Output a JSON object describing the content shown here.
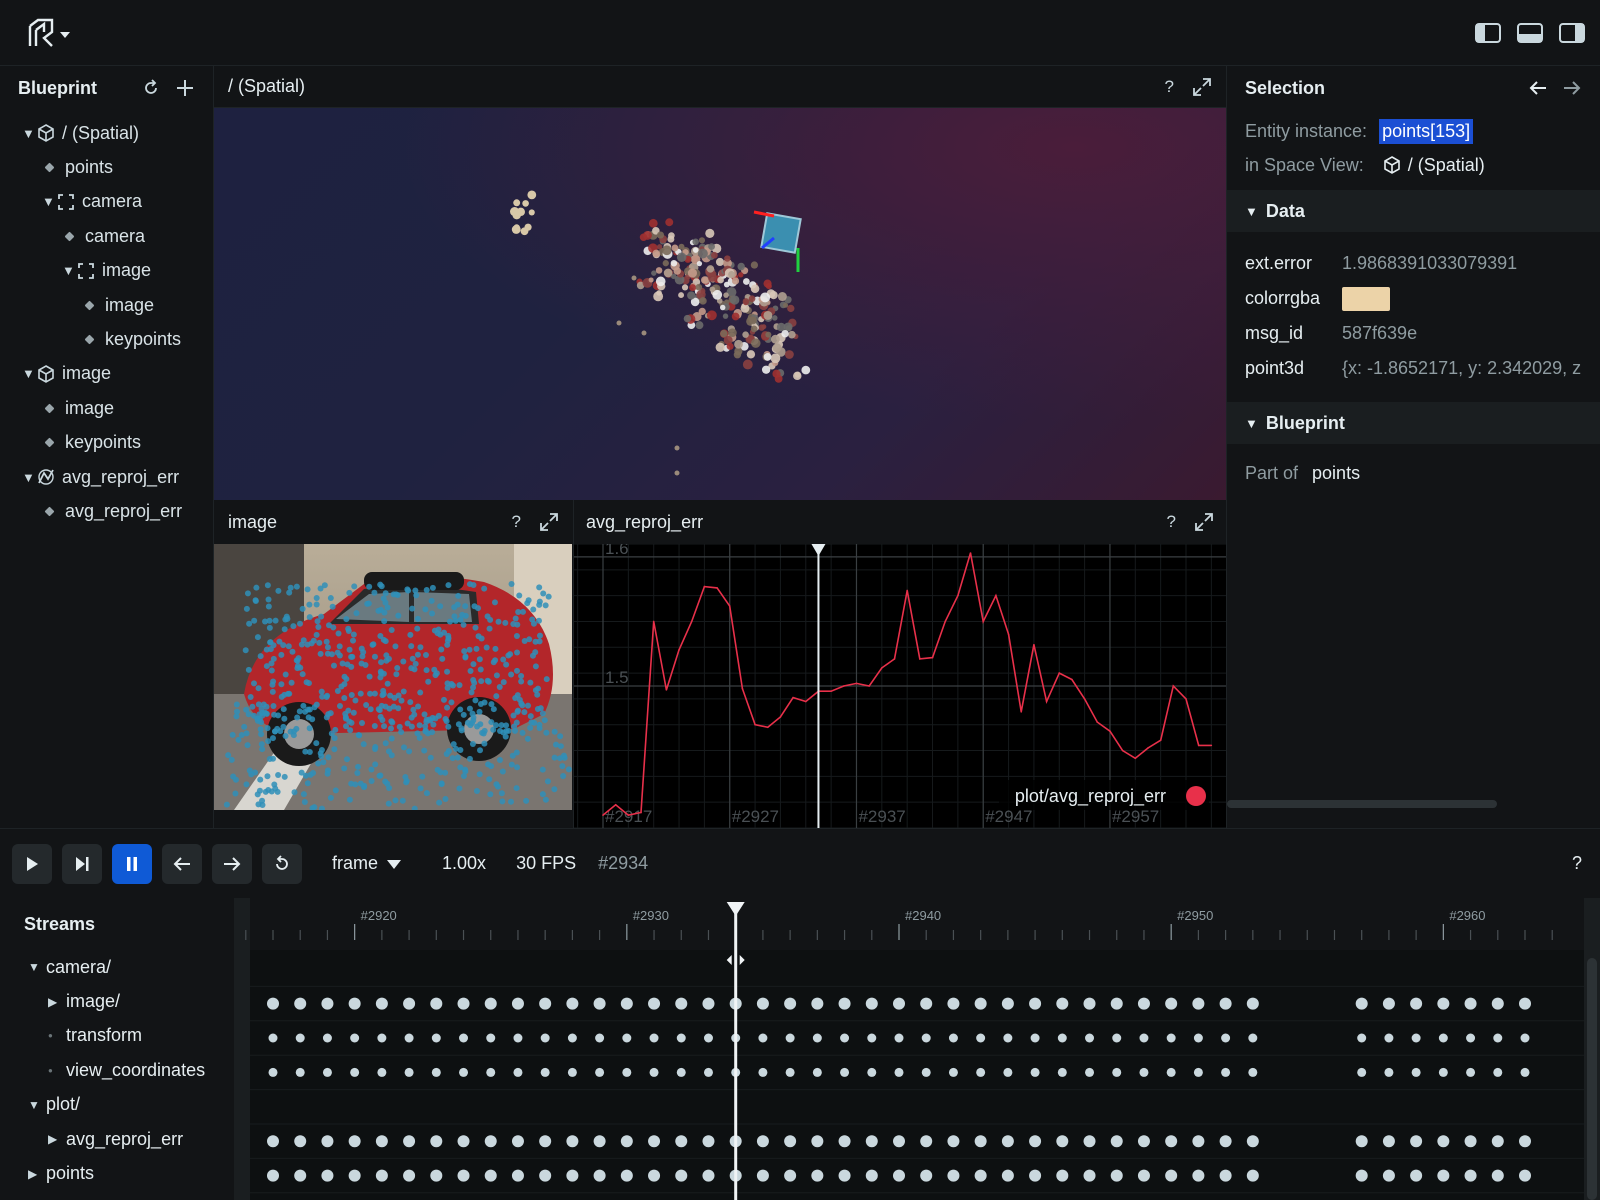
{
  "blueprint": {
    "title": "Blueprint",
    "tree": [
      {
        "label": "/ (Spatial)",
        "indent": 0,
        "kind": "expanded",
        "icon": "cube-icon"
      },
      {
        "label": "points",
        "indent": 1,
        "kind": "leaf",
        "icon": ""
      },
      {
        "label": "camera",
        "indent": 1,
        "kind": "expanded",
        "icon": "frame-icon"
      },
      {
        "label": "camera",
        "indent": 2,
        "kind": "leaf",
        "icon": ""
      },
      {
        "label": "image",
        "indent": 2,
        "kind": "expanded",
        "icon": "frame-icon"
      },
      {
        "label": "image",
        "indent": 3,
        "kind": "leaf",
        "icon": ""
      },
      {
        "label": "keypoints",
        "indent": 3,
        "kind": "leaf",
        "icon": ""
      },
      {
        "label": "image",
        "indent": 0,
        "kind": "expanded",
        "icon": "cube-icon"
      },
      {
        "label": "image",
        "indent": 1,
        "kind": "leaf",
        "icon": ""
      },
      {
        "label": "keypoints",
        "indent": 1,
        "kind": "leaf",
        "icon": ""
      },
      {
        "label": "avg_reproj_err",
        "indent": 0,
        "kind": "expanded",
        "icon": "chart-icon"
      },
      {
        "label": "avg_reproj_err",
        "indent": 1,
        "kind": "leaf",
        "icon": ""
      }
    ]
  },
  "spatial": {
    "title": "/ (Spatial)",
    "help": "?"
  },
  "image_view": {
    "title": "image",
    "help": "?"
  },
  "plot_view": {
    "title": "avg_reproj_err",
    "help": "?",
    "legend": "plot/avg_reproj_err",
    "legend_color": "#e8304a",
    "y_ticks": [
      "1.6",
      "1.5"
    ],
    "x_ticks": [
      "#2917",
      "#2927",
      "#2937",
      "#2947",
      "#2957"
    ]
  },
  "chart_data": {
    "type": "line",
    "title": "",
    "xlabel": "",
    "ylabel": "",
    "series": [
      {
        "name": "plot/avg_reproj_err",
        "color": "#e8304a"
      }
    ],
    "x": [
      2917,
      2918,
      2919,
      2920,
      2921,
      2922,
      2923,
      2924,
      2925,
      2926,
      2927,
      2928,
      2929,
      2930,
      2931,
      2932,
      2933,
      2934,
      2935,
      2936,
      2937,
      2938,
      2939,
      2940,
      2941,
      2942,
      2943,
      2944,
      2945,
      2946,
      2947,
      2948,
      2949,
      2950,
      2951,
      2952,
      2953,
      2954,
      2955,
      2956,
      2957,
      2958,
      2959,
      2960,
      2961,
      2962,
      2963,
      2964,
      2965
    ],
    "y": [
      1.4,
      1.408,
      1.4,
      1.402,
      1.55,
      1.497,
      1.528,
      1.55,
      1.577,
      1.576,
      1.562,
      1.498,
      1.47,
      1.468,
      1.476,
      1.491,
      1.488,
      1.496,
      1.496,
      1.5,
      1.502,
      1.5,
      1.514,
      1.521,
      1.574,
      1.521,
      1.522,
      1.55,
      1.57,
      1.603,
      1.55,
      1.57,
      1.54,
      1.48,
      1.532,
      1.488,
      1.51,
      1.505,
      1.49,
      1.472,
      1.465,
      1.45,
      1.444,
      1.452,
      1.458,
      1.5,
      1.49,
      1.454,
      1.454
    ],
    "ylim": [
      1.39,
      1.61
    ],
    "x_ticks": [
      2917,
      2927,
      2937,
      2947,
      2957
    ]
  },
  "selection": {
    "title": "Selection",
    "entity_label": "Entity instance:",
    "entity_value": "points[153]",
    "space_label": "in Space View:",
    "space_value": "/ (Spatial)",
    "data_section": "Data",
    "data_rows": [
      {
        "key": "ext.error",
        "value": "1.9868391033079391"
      },
      {
        "key": "colorrgba",
        "value": "",
        "swatch": "#ecd3a8"
      },
      {
        "key": "msg_id",
        "value": "587f639e"
      },
      {
        "key": "point3d",
        "value": "{x: -1.8652171, y: 2.342029, z"
      }
    ],
    "blueprint_section": "Blueprint",
    "part_of_label": "Part of",
    "part_of_value": "points"
  },
  "timeline": {
    "timeline_name": "frame",
    "speed": "1.00x",
    "fps": "30 FPS",
    "current": "#2934",
    "help": "?",
    "streams_title": "Streams",
    "ruler_labels": [
      "#2920",
      "#2930",
      "#2940",
      "#2950",
      "#2960"
    ],
    "ruler_label_frames": [
      2920,
      2930,
      2940,
      2950,
      2960
    ],
    "cursor_frame": 2934,
    "first_frame": 2917,
    "last_frame": 2963,
    "gap_frames": [
      2954,
      2955,
      2956
    ],
    "streams": [
      {
        "label": "camera/",
        "indent": 0,
        "kind": "expanded",
        "has_events": false
      },
      {
        "label": "image/",
        "indent": 1,
        "kind": "collapsed",
        "has_events": true
      },
      {
        "label": "transform",
        "indent": 1,
        "kind": "leaf",
        "has_events": true
      },
      {
        "label": "view_coordinates",
        "indent": 1,
        "kind": "leaf",
        "has_events": true
      },
      {
        "label": "plot/",
        "indent": 0,
        "kind": "expanded",
        "has_events": false
      },
      {
        "label": "avg_reproj_err",
        "indent": 1,
        "kind": "collapsed",
        "has_events": true
      },
      {
        "label": "points",
        "indent": 0,
        "kind": "collapsed",
        "has_events": true
      }
    ]
  }
}
